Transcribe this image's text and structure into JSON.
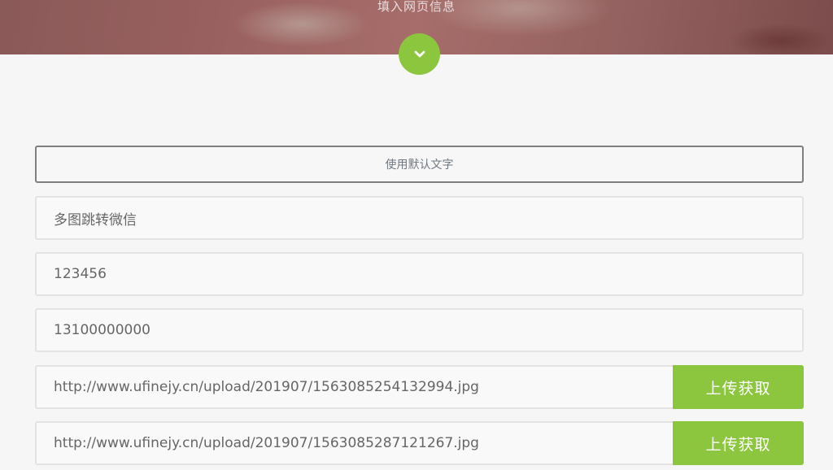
{
  "header": {
    "subtitle": "填入网页信息"
  },
  "form": {
    "default_text_button": "使用默认文字",
    "title_field": {
      "value": "多图跳转微信"
    },
    "password_field": {
      "value": "123456"
    },
    "phone_field": {
      "value": "13100000000"
    },
    "image_rows": [
      {
        "url": "http://www.ufinejy.cn/upload/201907/1563085254132994.jpg",
        "button": "上传获取"
      },
      {
        "url": "http://www.ufinejy.cn/upload/201907/1563085287121267.jpg",
        "button": "上传获取"
      }
    ]
  },
  "colors": {
    "accent": "#8cc63f",
    "page_background": "#f7f6f6",
    "field_border": "#e3e3e3",
    "button_border": "#7f7f7f"
  },
  "icons": {
    "scroll_down": "chevron-down-icon"
  }
}
